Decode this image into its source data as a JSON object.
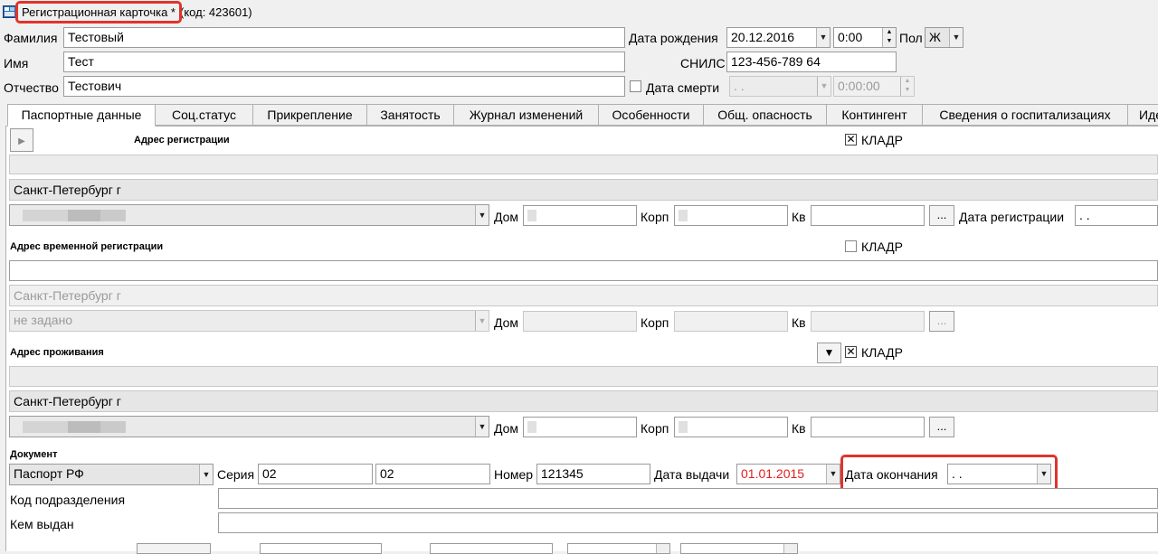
{
  "window": {
    "title": "Регистрационная карточка *",
    "code": "(код: 423601)"
  },
  "person": {
    "surname_label": "Фамилия",
    "surname": "Тестовый",
    "name_label": "Имя",
    "name": "Тест",
    "patronymic_label": "Отчество",
    "patronymic": "Тестович",
    "birth_date_label": "Дата рождения",
    "birth_date": "20.12.2016",
    "birth_time": "0:00",
    "gender_label": "Пол",
    "gender": "Ж",
    "snils_label": "СНИЛС",
    "snils": "123-456-789 64",
    "death_date_label": "Дата смерти",
    "death_date": " .  .",
    "death_time": "0:00:00"
  },
  "tabs": [
    {
      "label": "Паспортные данные"
    },
    {
      "label": "Соц.статус"
    },
    {
      "label": "Прикрепление"
    },
    {
      "label": "Занятость"
    },
    {
      "label": "Журнал изменений"
    },
    {
      "label": "Особенности"
    },
    {
      "label": "Общ. опасность"
    },
    {
      "label": "Контингент"
    },
    {
      "label": "Сведения о госпитализациях"
    },
    {
      "label": "Иден"
    }
  ],
  "labels": {
    "house": "Дом",
    "building": "Корп",
    "flat": "Кв",
    "kladr": "КЛАДР",
    "more": "...",
    "registration_date": "Дата регистрации"
  },
  "reg_address": {
    "title": "Адрес регистрации",
    "city": "Санкт-Петербург г",
    "registration_date": " .  ."
  },
  "temp_address": {
    "title": "Адрес временной регистрации",
    "city": "Санкт-Петербург г",
    "street": "не задано"
  },
  "live_address": {
    "title": "Адрес проживания",
    "city": "Санкт-Петербург г"
  },
  "document": {
    "title": "Документ",
    "type": "Паспорт РФ",
    "series_label": "Серия",
    "series1": "02",
    "series2": "02",
    "number_label": "Номер",
    "number": "121345",
    "issue_date_label": "Дата выдачи",
    "issue_date": "01.01.2015",
    "end_date_label": "Дата окончания",
    "end_date": " .  .",
    "division_code_label": "Код подразделения",
    "issued_by_label": "Кем выдан"
  },
  "colors": {
    "highlight": "#e0342c",
    "issue_date": "#e02020"
  }
}
